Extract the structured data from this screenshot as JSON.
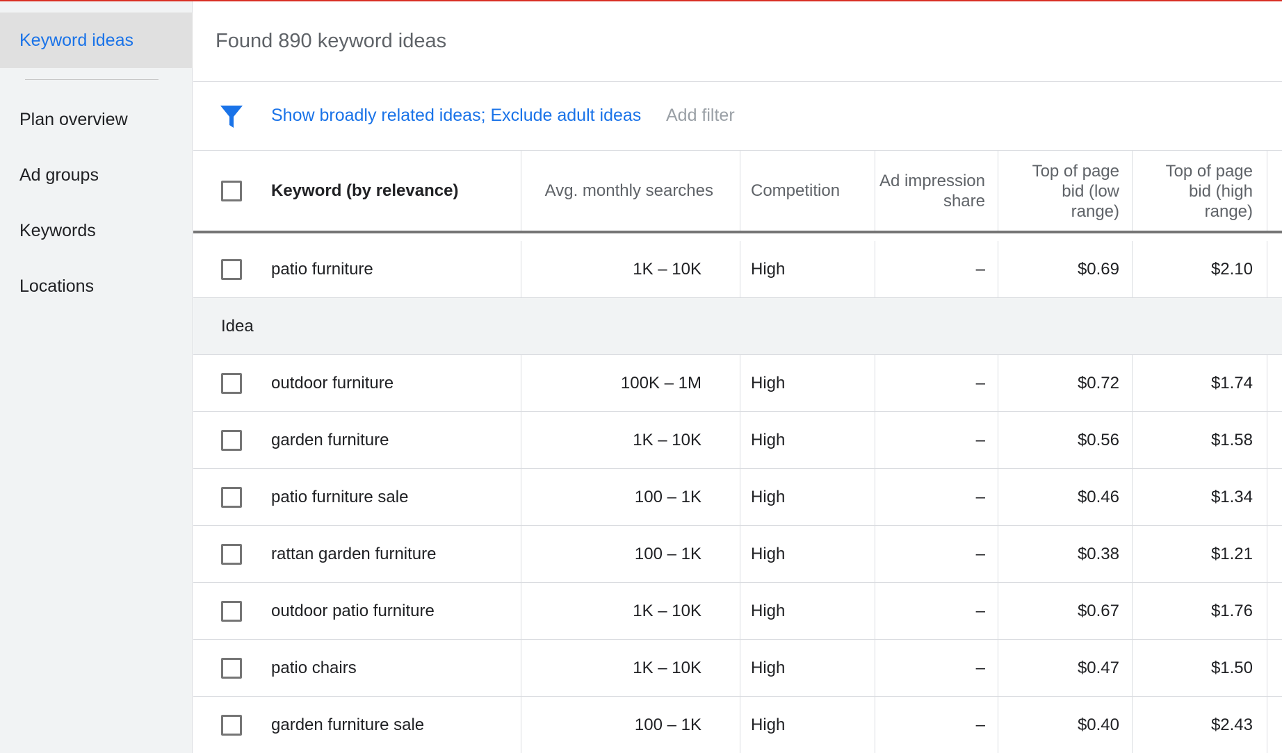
{
  "sidebar": {
    "active": "Keyword ideas",
    "items": [
      {
        "label": "Plan overview"
      },
      {
        "label": "Ad groups"
      },
      {
        "label": "Keywords"
      },
      {
        "label": "Locations"
      }
    ]
  },
  "header": {
    "found_text": "Found 890 keyword ideas"
  },
  "filter": {
    "icon": "filter-funnel-icon",
    "active_filters": "Show broadly related ideas; Exclude adult ideas",
    "add_filter": "Add filter"
  },
  "table": {
    "columns": {
      "keyword": "Keyword (by relevance)",
      "avg_monthly": "Avg. monthly searches",
      "competition": "Competition",
      "ad_impression_1": "Ad impression",
      "ad_impression_2": "share",
      "low_1": "Top of page",
      "low_2": "bid (low",
      "low_3": "range)",
      "high_1": "Top of page",
      "high_2": "bid (high",
      "high_3": "range)"
    },
    "provided": {
      "keyword": "patio furniture",
      "avg": "1K – 10K",
      "competition": "High",
      "impression": "–",
      "low": "$0.69",
      "high": "$2.10"
    },
    "section_label": "Idea",
    "ideas": [
      {
        "keyword": "outdoor furniture",
        "avg": "100K – 1M",
        "competition": "High",
        "impression": "–",
        "low": "$0.72",
        "high": "$1.74"
      },
      {
        "keyword": "garden furniture",
        "avg": "1K – 10K",
        "competition": "High",
        "impression": "–",
        "low": "$0.56",
        "high": "$1.58"
      },
      {
        "keyword": "patio furniture sale",
        "avg": "100 – 1K",
        "competition": "High",
        "impression": "–",
        "low": "$0.46",
        "high": "$1.34"
      },
      {
        "keyword": "rattan garden furniture",
        "avg": "100 – 1K",
        "competition": "High",
        "impression": "–",
        "low": "$0.38",
        "high": "$1.21"
      },
      {
        "keyword": "outdoor patio furniture",
        "avg": "1K – 10K",
        "competition": "High",
        "impression": "–",
        "low": "$0.67",
        "high": "$1.76"
      },
      {
        "keyword": "patio chairs",
        "avg": "1K – 10K",
        "competition": "High",
        "impression": "–",
        "low": "$0.47",
        "high": "$1.50"
      },
      {
        "keyword": "garden furniture sale",
        "avg": "100 – 1K",
        "competition": "High",
        "impression": "–",
        "low": "$0.40",
        "high": "$2.43"
      }
    ]
  },
  "colors": {
    "accent_blue": "#1a73e8",
    "top_accent_red": "#d93025",
    "sidebar_bg": "#f1f3f4"
  }
}
